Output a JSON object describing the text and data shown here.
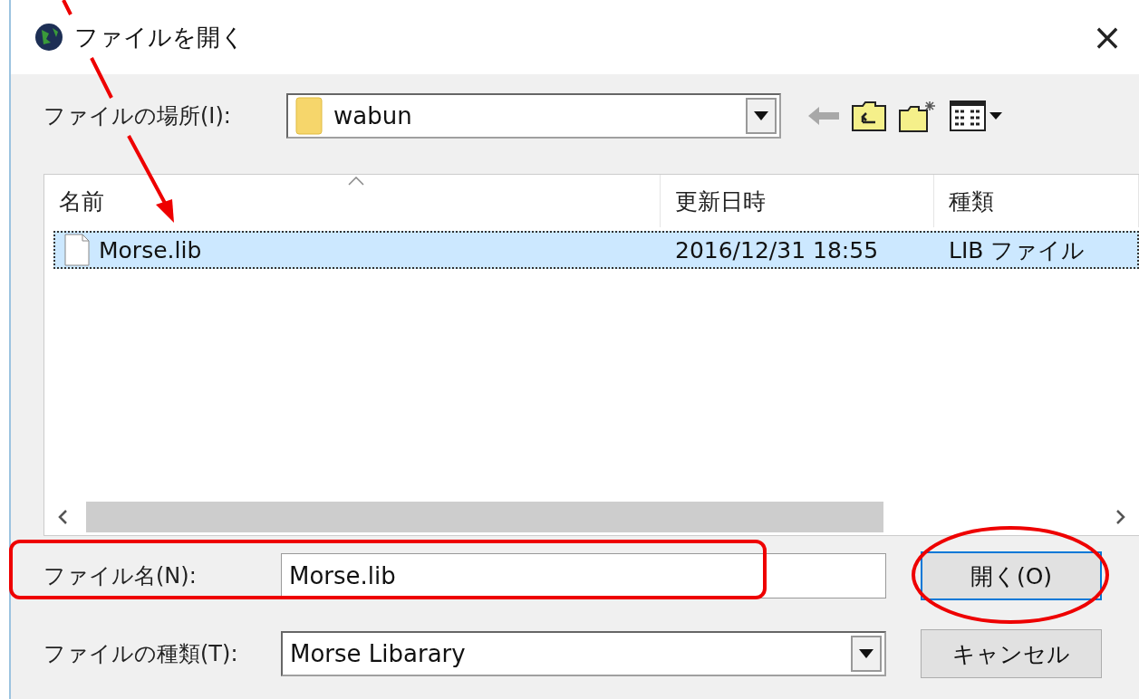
{
  "window": {
    "title": "ファイルを開く",
    "close": "×"
  },
  "location": {
    "label": "ファイルの場所(I):",
    "value": "wabun"
  },
  "file_list": {
    "columns": [
      {
        "label": "名前",
        "sorted": true
      },
      {
        "label": "更新日時",
        "sorted": false
      },
      {
        "label": "種類",
        "sorted": false
      }
    ],
    "rows": [
      {
        "name": "Morse.lib",
        "modified": "2016/12/31 18:55",
        "type": "LIB ファイル",
        "selected": true
      }
    ]
  },
  "file_name": {
    "label": "ファイル名(N):",
    "value": "Morse.lib"
  },
  "file_type": {
    "label": "ファイルの種類(T):",
    "value": "Morse Libarary"
  },
  "buttons": [
    {
      "label": "開く(O)",
      "kind": "default"
    },
    {
      "label": "キャンセル",
      "kind": "normal"
    }
  ]
}
